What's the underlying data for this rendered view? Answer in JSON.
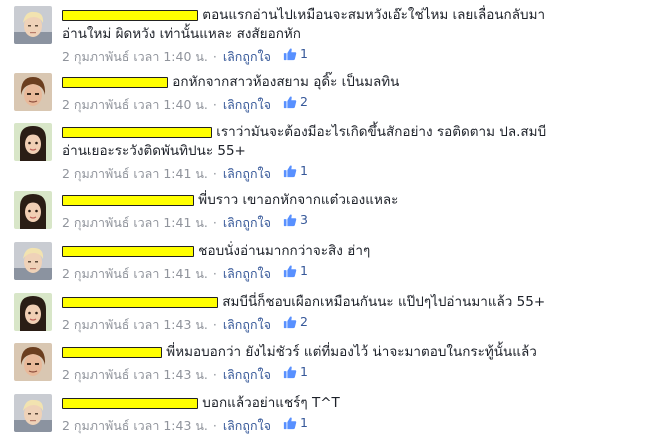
{
  "comments": [
    {
      "text_line1": "ตอนแรกอ่านไปเหมือนจะสมหวังเอ๊ะใช่ไหม เลยเลื่อนกลับมา",
      "text_line2": "อ่านใหม่ ผิดหวัง เท่านั้นแหละ สงสัยอกหัก",
      "timestamp": "2 กุมภาพันธ์ เวลา 1:40 น.",
      "unlike_label": "เลิกถูกใจ",
      "like_count": "1",
      "avatar_icon": "avatar-blond-man"
    },
    {
      "text_line1": "อกหักจากสาวห้องสยาม อุดิ๊ะ เป็นมลทิน",
      "timestamp": "2 กุมภาพันธ์ เวลา 1:40 น.",
      "unlike_label": "เลิกถูกใจ",
      "like_count": "2",
      "avatar_icon": "avatar-brown-hair-man"
    },
    {
      "text_line1": "เราว่ามันจะต้องมีอะไรเกิดขึ้นสักอย่าง รอติดตาม ปล.สมบี",
      "text_line2": "อ่านเยอะระวังติดพันทิปนะ 55+",
      "timestamp": "2 กุมภาพันธ์ เวลา 1:41 น.",
      "unlike_label": "เลิกถูกใจ",
      "like_count": "1",
      "avatar_icon": "avatar-dark-hair-woman"
    },
    {
      "text_line1": "พี่บราว เขาอกหักจากแต๋วเองแหละ",
      "timestamp": "2 กุมภาพันธ์ เวลา 1:41 น.",
      "unlike_label": "เลิกถูกใจ",
      "like_count": "3",
      "avatar_icon": "avatar-dark-hair-woman"
    },
    {
      "text_line1": "ชอบนั่งอ่านมากกว่าจะสิง ฮ่าๆ",
      "timestamp": "2 กุมภาพันธ์ เวลา 1:41 น.",
      "unlike_label": "เลิกถูกใจ",
      "like_count": "1",
      "avatar_icon": "avatar-blond-man"
    },
    {
      "text_line1": "สมบีนี่ก็ชอบเผือกเหมือนกันนะ แป๊ปๆไปอ่านมาแล้ว 55+",
      "timestamp": "2 กุมภาพันธ์ เวลา 1:43 น.",
      "unlike_label": "เลิกถูกใจ",
      "like_count": "2",
      "avatar_icon": "avatar-dark-hair-woman"
    },
    {
      "text_line1": "พี่หมอบอกว่า ยังไม่ชัวร์ แต่ที่มองไว้ น่าจะมาตอบในกระทู้นั้นแล้ว",
      "timestamp": "2 กุมภาพันธ์ เวลา 1:43 น.",
      "unlike_label": "เลิกถูกใจ",
      "like_count": "1",
      "avatar_icon": "avatar-brown-hair-man"
    },
    {
      "text_line1": "บอกแล้วอย่าแชร์ๆ T^T",
      "timestamp": "2 กุมภาพันธ์ เวลา 1:43 น.",
      "unlike_label": "เลิกถูกใจ",
      "like_count": "1",
      "avatar_icon": "avatar-blond-man"
    }
  ],
  "colors": {
    "link_blue": "#365899",
    "meta_gray": "#90949c",
    "redaction_yellow": "#ffff00"
  }
}
